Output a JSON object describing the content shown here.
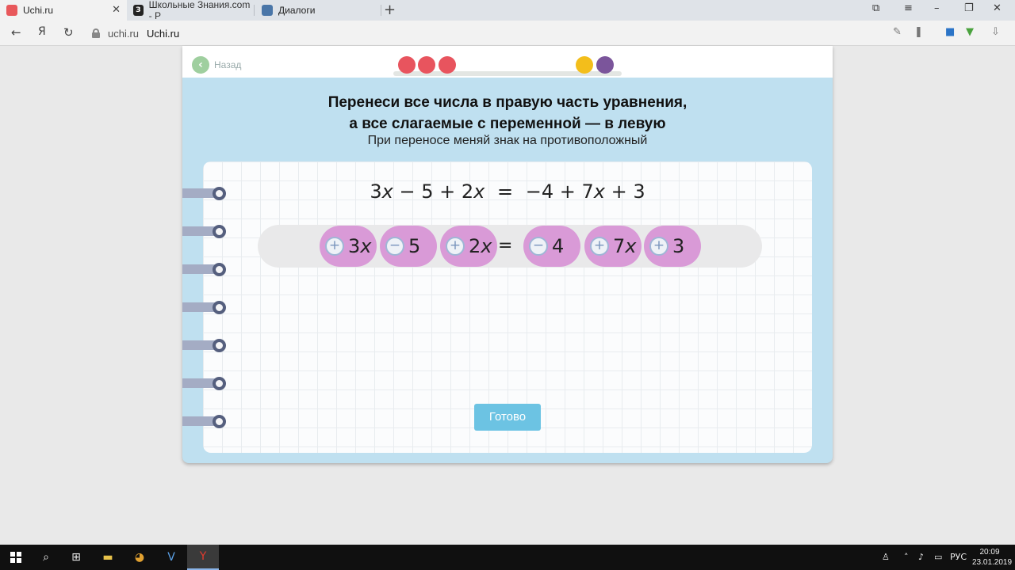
{
  "browser": {
    "tabs": [
      {
        "title": "Uchi.ru",
        "favicon_color": "#e8585b"
      },
      {
        "title": "Школьные Знания.com - Р",
        "favicon_color": "#222222",
        "favicon_glyph": "З"
      },
      {
        "title": "Диалоги",
        "favicon_color": "#4a76a8"
      }
    ],
    "new_tab_icon": "+",
    "nav": {
      "back_icon": "←",
      "yandex_icon": "Я",
      "reload_icon": "↻"
    },
    "address": {
      "domain": "uchi.ru",
      "page_title": "Uchi.ru"
    }
  },
  "lesson": {
    "back_label": "Назад",
    "progress_dots": [
      "#e8545e",
      "#e8545e",
      "#e8545e",
      "#f3be1b",
      "#7b559b"
    ],
    "title_line1": "Перенеси все числа в правую часть уравнения,",
    "title_line2": "а все слагаемые с переменной — в левую",
    "subtitle": "При переносе меняй знак на противоположный",
    "equation": {
      "left": [
        "3",
        "x",
        " − 5 + 2",
        "x"
      ],
      "eq": "=",
      "right": [
        "−4 + 7",
        "x",
        " + 3"
      ]
    },
    "chips_left": [
      {
        "sign": "+",
        "num": "3",
        "var": "x"
      },
      {
        "sign": "−",
        "num": "5",
        "var": ""
      },
      {
        "sign": "+",
        "num": "2",
        "var": "x"
      }
    ],
    "equals": "=",
    "chips_right": [
      {
        "sign": "−",
        "num": "4",
        "var": ""
      },
      {
        "sign": "+",
        "num": "7",
        "var": "x"
      },
      {
        "sign": "+",
        "num": "3",
        "var": ""
      }
    ],
    "ready_button": "Готово"
  },
  "taskbar": {
    "time": "20:09",
    "date": "23.01.2019",
    "lang": "РУС"
  }
}
